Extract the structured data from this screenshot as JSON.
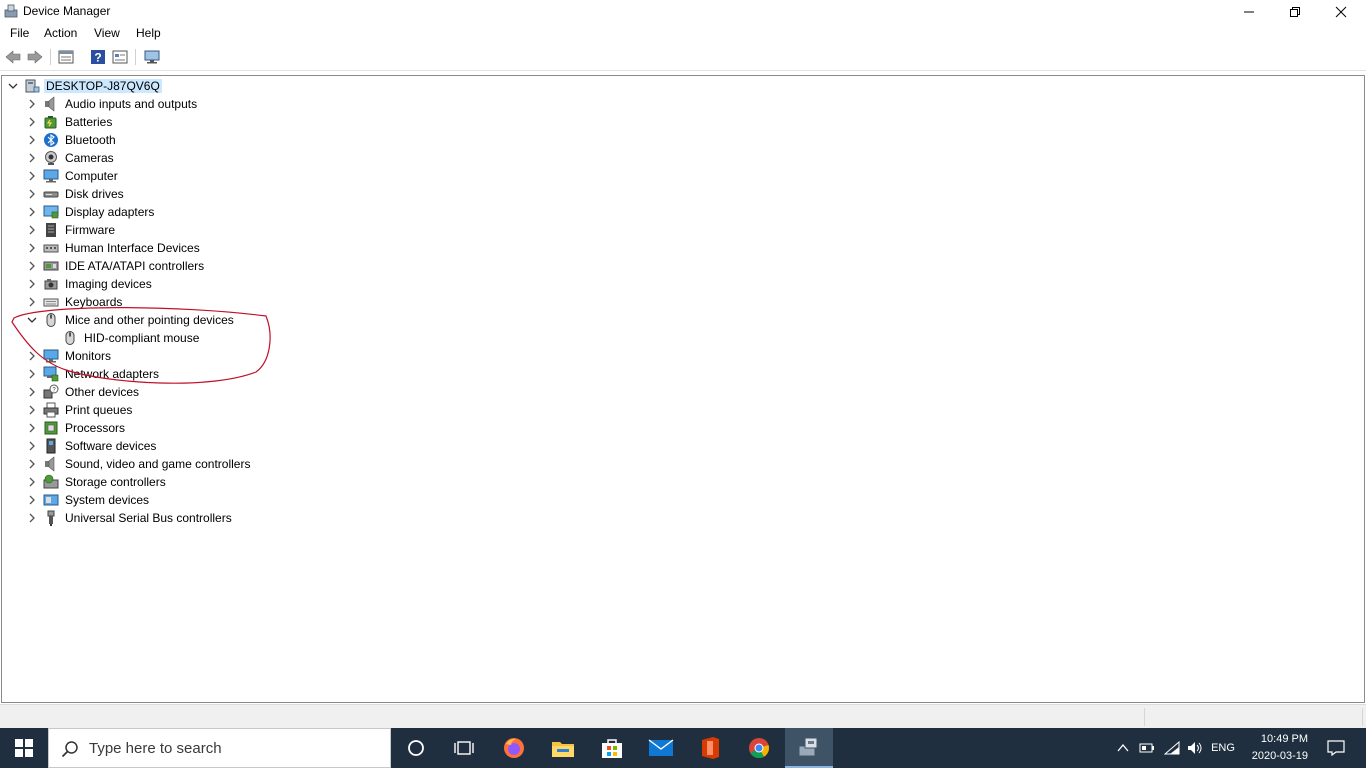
{
  "window": {
    "title": "Device Manager",
    "controls": [
      "minimize",
      "restore",
      "close"
    ]
  },
  "menu": [
    {
      "label": "File"
    },
    {
      "label": "Action"
    },
    {
      "label": "View"
    },
    {
      "label": "Help"
    }
  ],
  "toolbar": {
    "icons": [
      "back-arrow-icon",
      "forward-arrow-icon",
      "properties-icon",
      "help-icon",
      "view-icon",
      "monitor-icon"
    ]
  },
  "tree": {
    "root": {
      "label": "DESKTOP-J87QV6Q",
      "expanded": true,
      "selected": true
    },
    "categories": [
      {
        "label": "Audio inputs and outputs",
        "icon": "speaker-icon"
      },
      {
        "label": "Batteries",
        "icon": "battery-icon"
      },
      {
        "label": "Bluetooth",
        "icon": "bluetooth-icon"
      },
      {
        "label": "Cameras",
        "icon": "camera-icon"
      },
      {
        "label": "Computer",
        "icon": "computer-icon"
      },
      {
        "label": "Disk drives",
        "icon": "disk-drive-icon"
      },
      {
        "label": "Display adapters",
        "icon": "display-adapter-icon"
      },
      {
        "label": "Firmware",
        "icon": "firmware-icon"
      },
      {
        "label": "Human Interface Devices",
        "icon": "hid-icon"
      },
      {
        "label": "IDE ATA/ATAPI controllers",
        "icon": "ide-controller-icon"
      },
      {
        "label": "Imaging devices",
        "icon": "imaging-icon"
      },
      {
        "label": "Keyboards",
        "icon": "keyboard-icon"
      },
      {
        "label": "Mice and other pointing devices",
        "icon": "mouse-icon",
        "expanded": true,
        "children": [
          {
            "label": "HID-compliant mouse",
            "icon": "mouse-icon"
          }
        ]
      },
      {
        "label": "Monitors",
        "icon": "monitor-icon"
      },
      {
        "label": "Network adapters",
        "icon": "network-adapter-icon"
      },
      {
        "label": "Other devices",
        "icon": "other-devices-icon"
      },
      {
        "label": "Print queues",
        "icon": "printer-icon"
      },
      {
        "label": "Processors",
        "icon": "processor-icon"
      },
      {
        "label": "Software devices",
        "icon": "software-device-icon"
      },
      {
        "label": "Sound, video and game controllers",
        "icon": "sound-icon"
      },
      {
        "label": "Storage controllers",
        "icon": "storage-controller-icon"
      },
      {
        "label": "System devices",
        "icon": "system-devices-icon"
      },
      {
        "label": "Universal Serial Bus controllers",
        "icon": "usb-icon"
      }
    ]
  },
  "taskbar": {
    "search_placeholder": "Type here to search",
    "apps": [
      "cortana-icon",
      "task-view-icon",
      "firefox-icon",
      "file-explorer-icon",
      "store-icon",
      "mail-icon",
      "office-icon",
      "chrome-icon",
      "device-manager-icon"
    ],
    "tray": {
      "language": "ENG",
      "time": "10:49 PM",
      "date": "2020-03-19"
    }
  },
  "colors": {
    "selection": "#cce8ff",
    "taskbar": "#1f2f3f",
    "annotation": "#c0102a",
    "active_app": "#3f5367"
  }
}
